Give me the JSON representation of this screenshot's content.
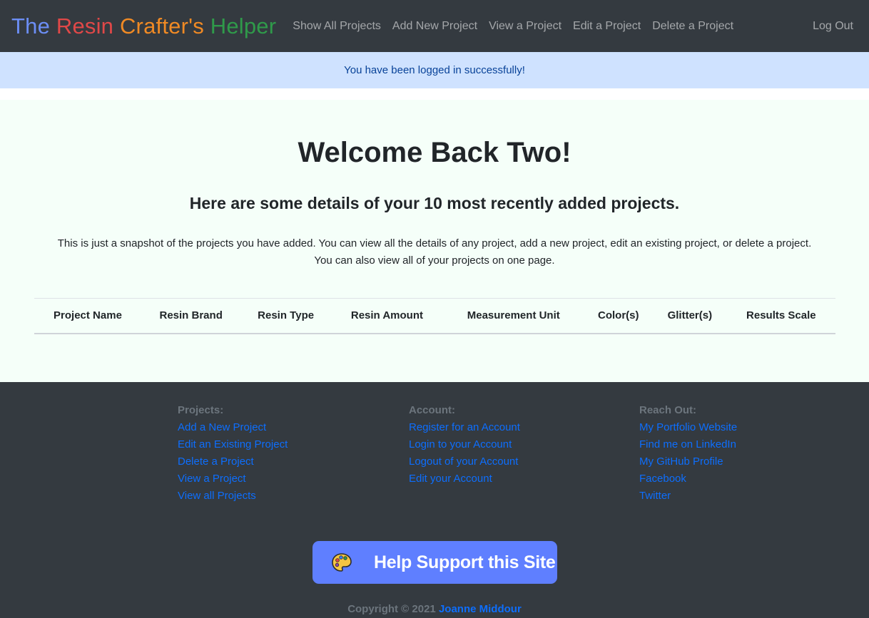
{
  "navbar": {
    "brand": {
      "words": [
        {
          "text": "The",
          "color": "#6c8ef5"
        },
        {
          "text": "Resin",
          "color": "#e04848"
        },
        {
          "text": "Crafter's",
          "color": "#f08a24"
        },
        {
          "text": "Helper",
          "color": "#2f9a4a"
        }
      ]
    },
    "links": [
      "Show All Projects",
      "Add New Project",
      "View a Project",
      "Edit a Project",
      "Delete a Project"
    ],
    "logout": "Log Out"
  },
  "alert": {
    "message": "You have been logged in successfully!"
  },
  "main": {
    "welcome": "Welcome Back Two!",
    "subheading": "Here are some details of your 10 most recently added projects.",
    "intro_line1": "This is just a snapshot of the projects you have added. You can view all the details of any project, add a new project, edit an existing project, or delete a project.",
    "intro_line2": "You can also view all of your projects on one page.",
    "table": {
      "headers": [
        "Project Name",
        "Resin Brand",
        "Resin Type",
        "Resin Amount",
        "Measurement Unit",
        "Color(s)",
        "Glitter(s)",
        "Results Scale"
      ],
      "rows": []
    }
  },
  "footer": {
    "columns": [
      {
        "heading": "Projects:",
        "links": [
          "Add a New Project",
          "Edit an Existing Project",
          "Delete a Project",
          "View a Project",
          "View all Projects"
        ]
      },
      {
        "heading": "Account:",
        "links": [
          "Register for an Account",
          "Login to your Account",
          "Logout of your Account",
          "Edit your Account"
        ]
      },
      {
        "heading": "Reach Out:",
        "links": [
          "My Portfolio Website",
          "Find me on LinkedIn",
          "My GitHub Profile",
          "Facebook",
          "Twitter"
        ]
      }
    ],
    "support_button": {
      "label": "Help Support this Site",
      "icon": "palette-icon"
    },
    "copyright_text": "Copyright © 2021",
    "copyright_author": "Joanne Middour"
  }
}
